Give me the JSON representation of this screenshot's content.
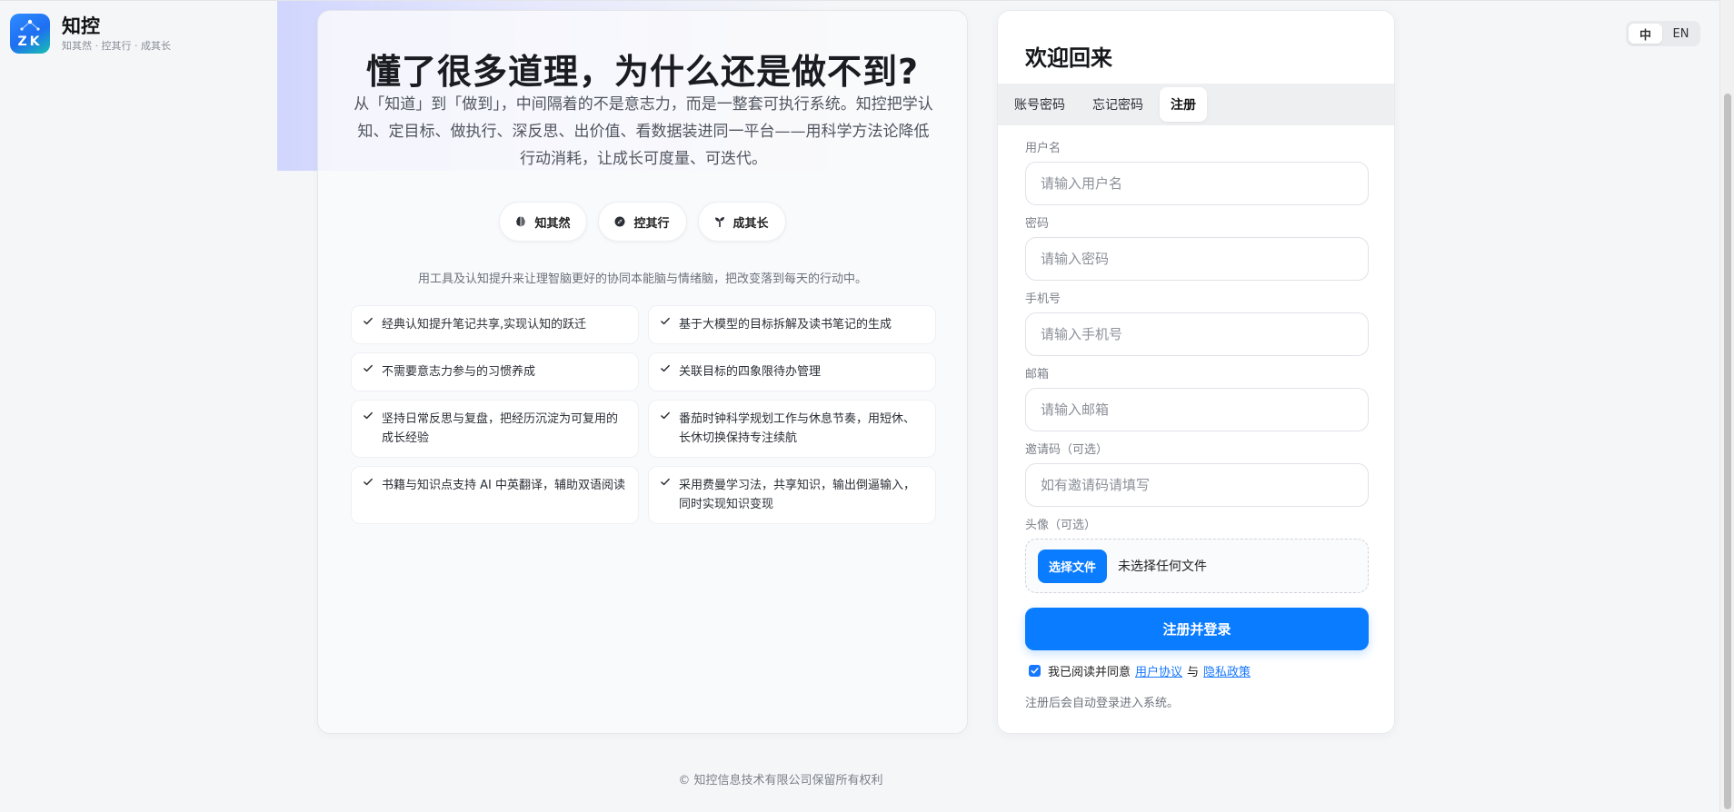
{
  "brand": {
    "name": "知控",
    "logo_text": "ZK",
    "subtitle": "知其然 · 控其行 · 成其长"
  },
  "language": {
    "options": [
      {
        "label": "中",
        "active": true
      },
      {
        "label": "EN",
        "active": false
      }
    ]
  },
  "hero": {
    "headline": "懂了很多道理，为什么还是做不到?",
    "intro": "从「知道」到「做到」，中间隔着的不是意志力，而是一整套可执行系统。知控把学认知、定目标、做执行、深反思、出价值、看数据装进同一平台——用科学方法论降低行动消耗，让成长可度量、可迭代。",
    "pills": [
      {
        "label": "知其然",
        "icon": "brain-icon"
      },
      {
        "label": "控其行",
        "icon": "compass-icon"
      },
      {
        "label": "成其长",
        "icon": "sprout-icon"
      }
    ],
    "tagline": "用工具及认知提升来让理智脑更好的协同本能脑与情绪脑，把改变落到每天的行动中。",
    "features": [
      "经典认知提升笔记共享,实现认知的跃迁",
      "基于大模型的目标拆解及读书笔记的生成",
      "不需要意志力参与的习惯养成",
      "关联目标的四象限待办管理",
      "坚持日常反思与复盘，把经历沉淀为可复用的成长经验",
      "番茄时钟科学规划工作与休息节奏，用短休、长休切换保持专注续航",
      "书籍与知识点支持 AI 中英翻译，辅助双语阅读",
      "采用费曼学习法，共享知识，输出倒逼输入，同时实现知识变现"
    ]
  },
  "auth": {
    "title": "欢迎回来",
    "tabs": [
      {
        "label": "账号密码",
        "active": false
      },
      {
        "label": "忘记密码",
        "active": false
      },
      {
        "label": "注册",
        "active": true
      }
    ],
    "fields": {
      "username": {
        "label": "用户名",
        "placeholder": "请输入用户名",
        "value": ""
      },
      "password": {
        "label": "密码",
        "placeholder": "请输入密码",
        "value": ""
      },
      "phone": {
        "label": "手机号",
        "placeholder": "请输入手机号",
        "value": ""
      },
      "email": {
        "label": "邮箱",
        "placeholder": "请输入邮箱",
        "value": ""
      },
      "invite": {
        "label": "邀请码（可选）",
        "placeholder": "如有邀请码请填写",
        "value": ""
      },
      "avatar": {
        "label": "头像（可选）",
        "button": "选择文件",
        "status": "未选择任何文件"
      }
    },
    "submit": "注册并登录",
    "agreement": {
      "checked": true,
      "prefix": "我已阅读并同意",
      "terms": "用户协议",
      "and": "与",
      "privacy": "隐私政策"
    },
    "note": "注册后会自动登录进入系统。"
  },
  "footer": {
    "copyright": "© 知控信息技术有限公司保留所有权利"
  },
  "colors": {
    "accent": "#0a7cff",
    "link": "#1677ff",
    "background": "#f5f6f8"
  }
}
